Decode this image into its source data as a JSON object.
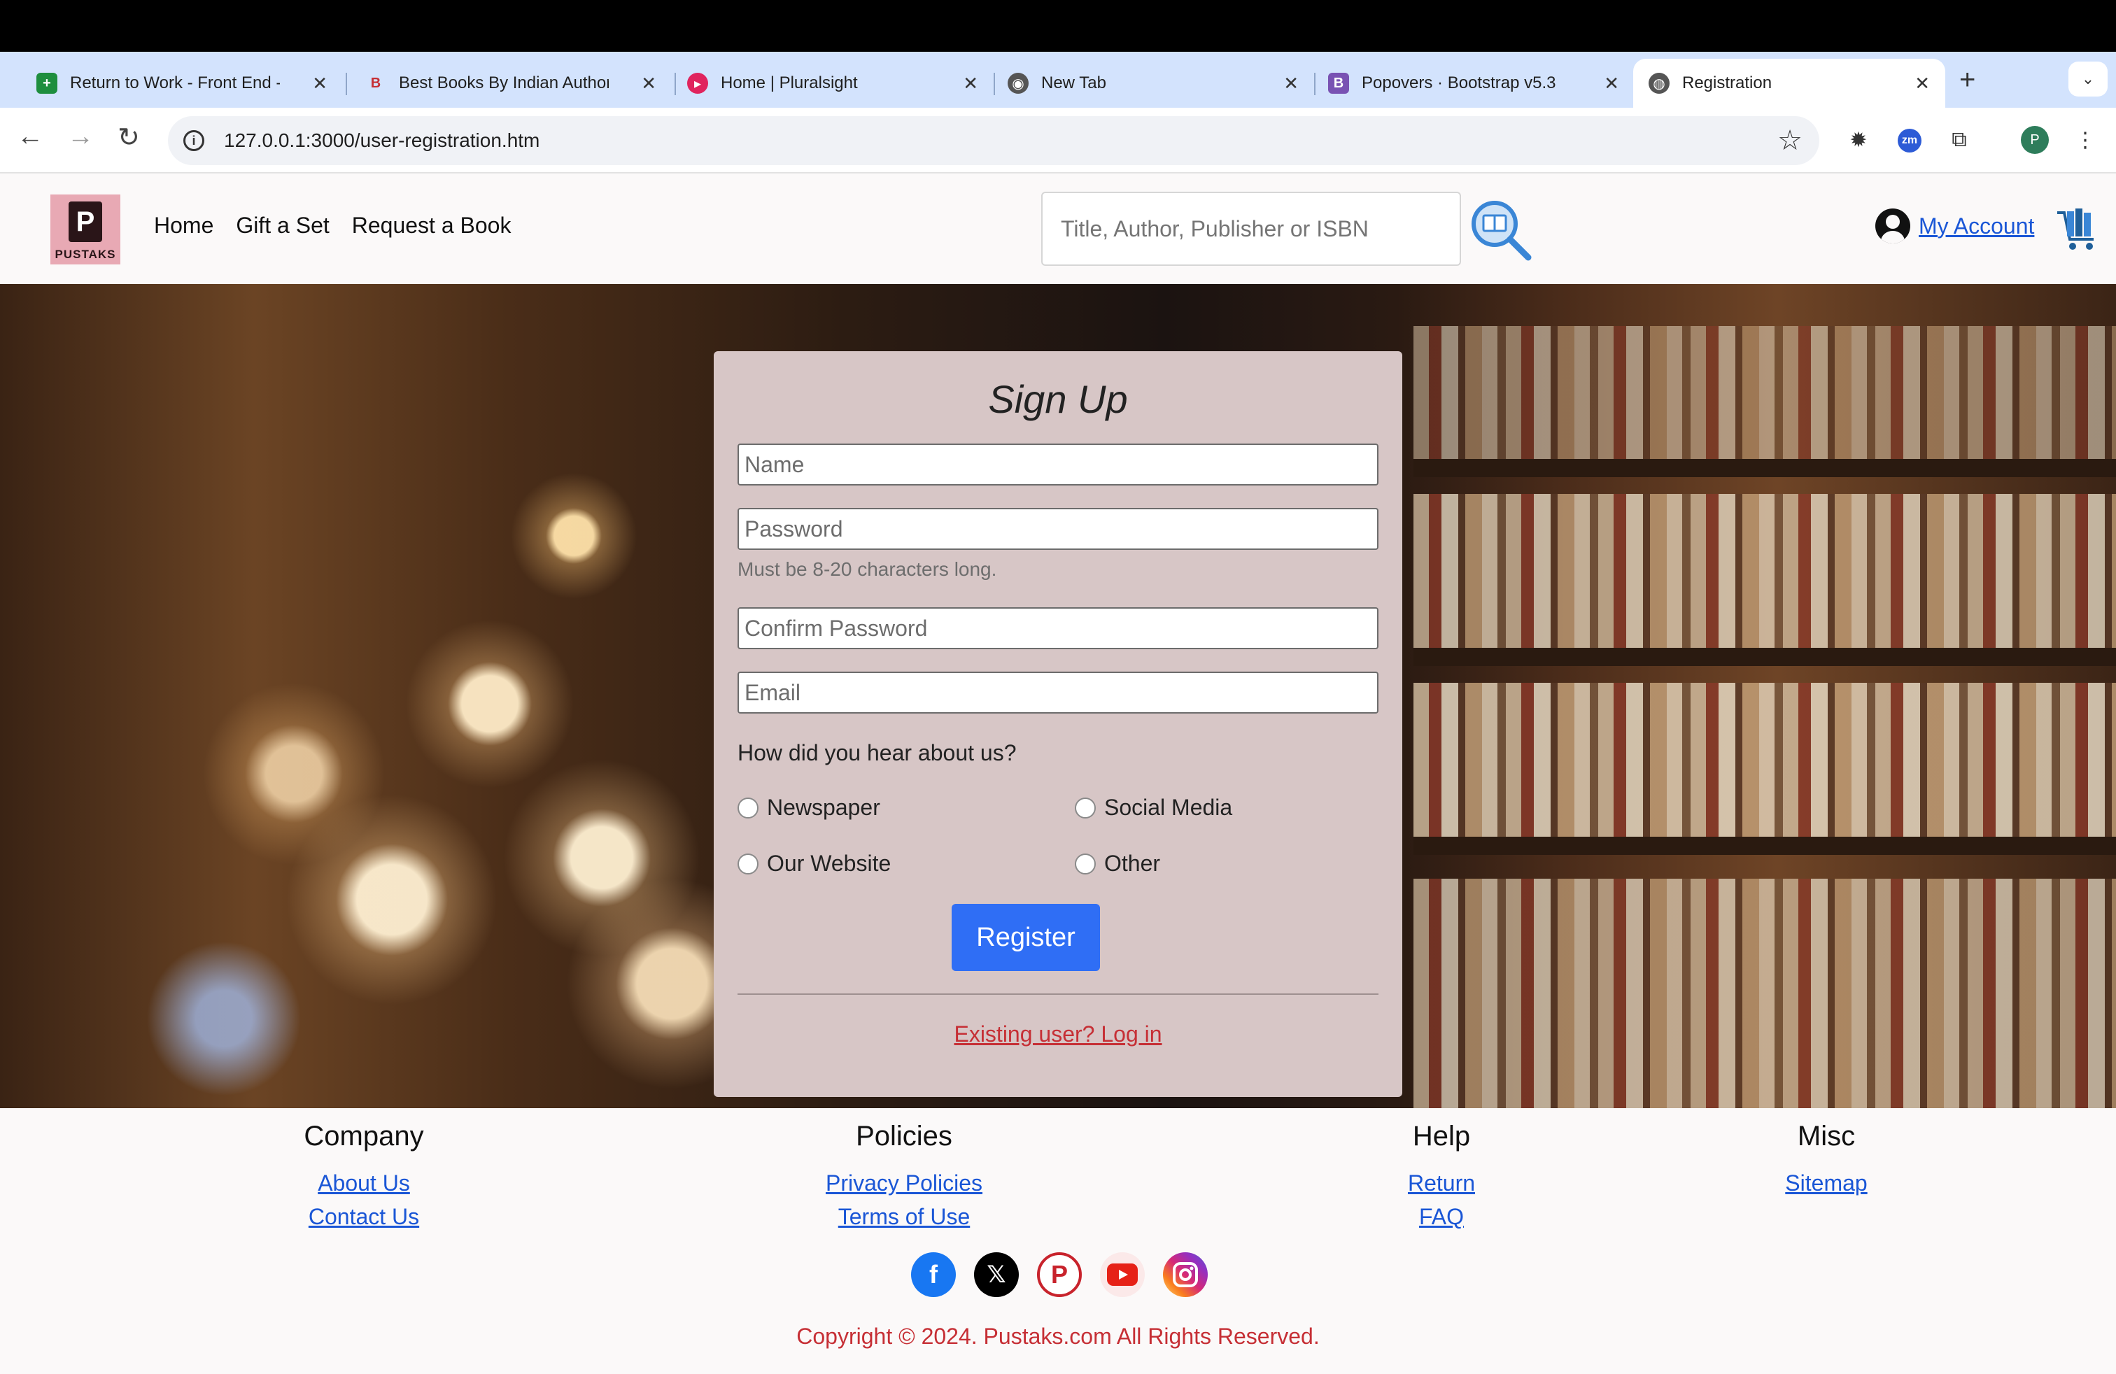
{
  "browser": {
    "tabs": [
      {
        "label": "Return to Work - Front End -",
        "icon": "sheets-icon",
        "color": "#1e8e3e"
      },
      {
        "label": "Best Books By Indian Author",
        "icon": "b-letter-icon",
        "color": "#c62f35"
      },
      {
        "label": "Home | Pluralsight",
        "icon": "pluralsight-icon",
        "color": "#e0245e"
      },
      {
        "label": "New Tab",
        "icon": "chrome-icon",
        "color": "#555555"
      },
      {
        "label": "Popovers · Bootstrap v5.3",
        "icon": "bootstrap-icon",
        "color": "#7952b3"
      },
      {
        "label": "Registration",
        "icon": "globe-icon",
        "color": "#555555"
      }
    ],
    "url": "127.0.0.1:3000/user-registration.htm"
  },
  "header": {
    "logo_text": "PUSTAKS",
    "nav": [
      "Home",
      "Gift a Set",
      "Request a Book"
    ],
    "search_placeholder": "Title, Author, Publisher or ISBN",
    "account_label": "My Account"
  },
  "form": {
    "title": "Sign Up",
    "name_placeholder": "Name",
    "password_placeholder": "Password",
    "password_hint": "Must be 8-20 characters long.",
    "confirm_placeholder": "Confirm Password",
    "email_placeholder": "Email",
    "question": "How did you hear about us?",
    "options": [
      "Newspaper",
      "Social Media",
      "Our Website",
      "Other"
    ],
    "register_label": "Register",
    "login_link": "Existing user? Log in"
  },
  "footer": {
    "columns": [
      {
        "title": "Company",
        "links": [
          "About Us",
          "Contact Us"
        ]
      },
      {
        "title": "Policies",
        "links": [
          "Privacy Policies",
          "Terms of Use"
        ]
      },
      {
        "title": "Help",
        "links": [
          "Return",
          "FAQ"
        ]
      },
      {
        "title": "Misc",
        "links": [
          "Sitemap"
        ]
      }
    ],
    "social": [
      "facebook-icon",
      "x-icon",
      "pinterest-icon",
      "youtube-icon",
      "instagram-icon"
    ],
    "copyright": "Copyright © 2024. Pustaks.com All Rights Reserved."
  },
  "colors": {
    "accent_blue": "#2f6ef5",
    "link_blue": "#1a56d6",
    "brand_red": "#c62f35",
    "card_bg": "#d7c6c6"
  }
}
